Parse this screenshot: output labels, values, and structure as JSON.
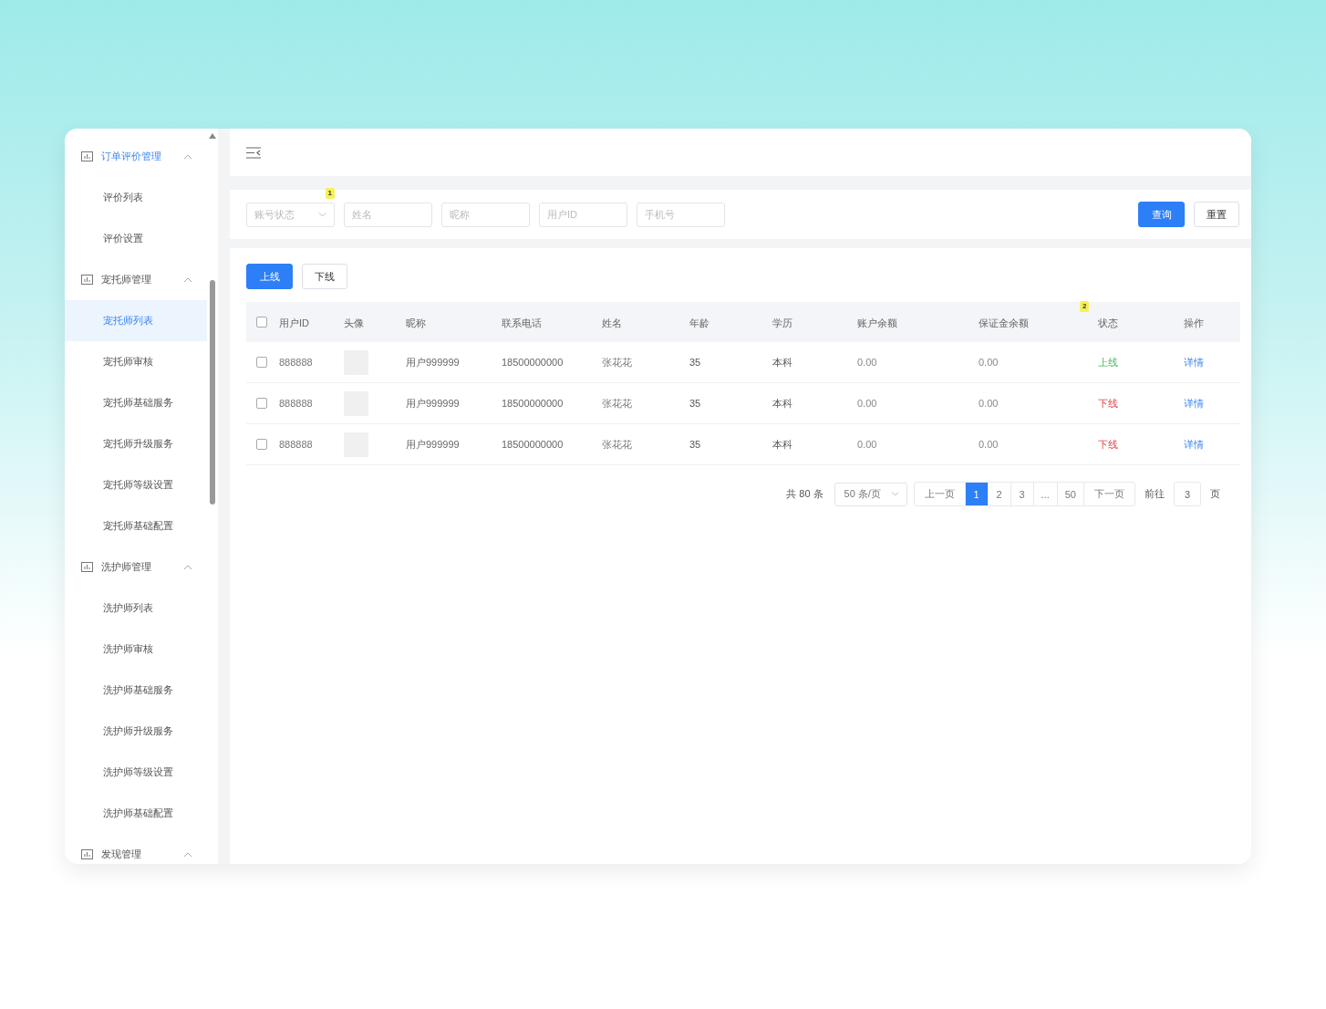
{
  "sidebar": {
    "groups": [
      {
        "title": "订单评价管理",
        "active": true,
        "expanded": true,
        "items": [
          {
            "label": "评价列表",
            "selected": false
          },
          {
            "label": "评价设置",
            "selected": false
          }
        ]
      },
      {
        "title": "宠托师管理",
        "active": false,
        "expanded": true,
        "items": [
          {
            "label": "宠托师列表",
            "selected": true
          },
          {
            "label": "宠托师审核",
            "selected": false
          },
          {
            "label": "宠托师基础服务",
            "selected": false
          },
          {
            "label": "宠托师升级服务",
            "selected": false
          },
          {
            "label": "宠托师等级设置",
            "selected": false
          },
          {
            "label": "宠托师基础配置",
            "selected": false
          }
        ]
      },
      {
        "title": "洗护师管理",
        "active": false,
        "expanded": true,
        "items": [
          {
            "label": "洗护师列表",
            "selected": false
          },
          {
            "label": "洗护师审核",
            "selected": false
          },
          {
            "label": "洗护师基础服务",
            "selected": false
          },
          {
            "label": "洗护师升级服务",
            "selected": false
          },
          {
            "label": "洗护师等级设置",
            "selected": false
          },
          {
            "label": "洗护师基础配置",
            "selected": false
          }
        ]
      },
      {
        "title": "发现管理",
        "active": false,
        "expanded": true
      }
    ]
  },
  "filters": {
    "marker": "1",
    "fields": [
      {
        "kind": "select",
        "placeholder": "账号状态"
      },
      {
        "kind": "input",
        "placeholder": "姓名"
      },
      {
        "kind": "input",
        "placeholder": "昵称"
      },
      {
        "kind": "input",
        "placeholder": "用户ID"
      },
      {
        "kind": "input",
        "placeholder": "手机号"
      }
    ],
    "buttons": [
      {
        "label": "查询",
        "primary": true
      },
      {
        "label": "重置",
        "primary": false
      }
    ]
  },
  "actions": [
    {
      "label": "上线",
      "primary": true
    },
    {
      "label": "下线",
      "primary": false
    }
  ],
  "table": {
    "header_checked": false,
    "columns": [
      {
        "label": "用户ID"
      },
      {
        "label": "头像"
      },
      {
        "label": "昵称"
      },
      {
        "label": "联系电话"
      },
      {
        "label": "姓名"
      },
      {
        "label": "年龄"
      },
      {
        "label": "学历"
      },
      {
        "label": "账户余额"
      },
      {
        "label": "保证金余额"
      },
      {
        "label": "状态",
        "marker": "2"
      },
      {
        "label": "操作"
      }
    ],
    "rows": [
      {
        "checked": false,
        "user_id": "888888",
        "nickname": "用户999999",
        "phone": "18500000000",
        "name": "张花花",
        "age": "35",
        "education": "本科",
        "balance": "0.00",
        "deposit": "0.00",
        "status": {
          "text": "上线",
          "kind": "online"
        },
        "action": "详情"
      },
      {
        "checked": false,
        "user_id": "888888",
        "nickname": "用户999999",
        "phone": "18500000000",
        "name": "张花花",
        "age": "35",
        "education": "本科",
        "balance": "0.00",
        "deposit": "0.00",
        "status": {
          "text": "下线",
          "kind": "offline"
        },
        "action": "详情"
      },
      {
        "checked": false,
        "user_id": "888888",
        "nickname": "用户999999",
        "phone": "18500000000",
        "name": "张花花",
        "age": "35",
        "education": "本科",
        "balance": "0.00",
        "deposit": "0.00",
        "status": {
          "text": "下线",
          "kind": "offline"
        },
        "action": "详情"
      }
    ]
  },
  "pagination": {
    "total": "共 80 条",
    "page_size": "50 条/页",
    "prev": "上一页",
    "pages": [
      {
        "label": "1",
        "selected": true
      },
      {
        "label": "2",
        "selected": false
      },
      {
        "label": "3",
        "selected": false
      },
      {
        "label": "...",
        "selected": false
      },
      {
        "label": "50",
        "selected": false
      }
    ],
    "next": "下一页",
    "goto_label": "前往",
    "goto_value": "3",
    "page_suffix": "页"
  }
}
